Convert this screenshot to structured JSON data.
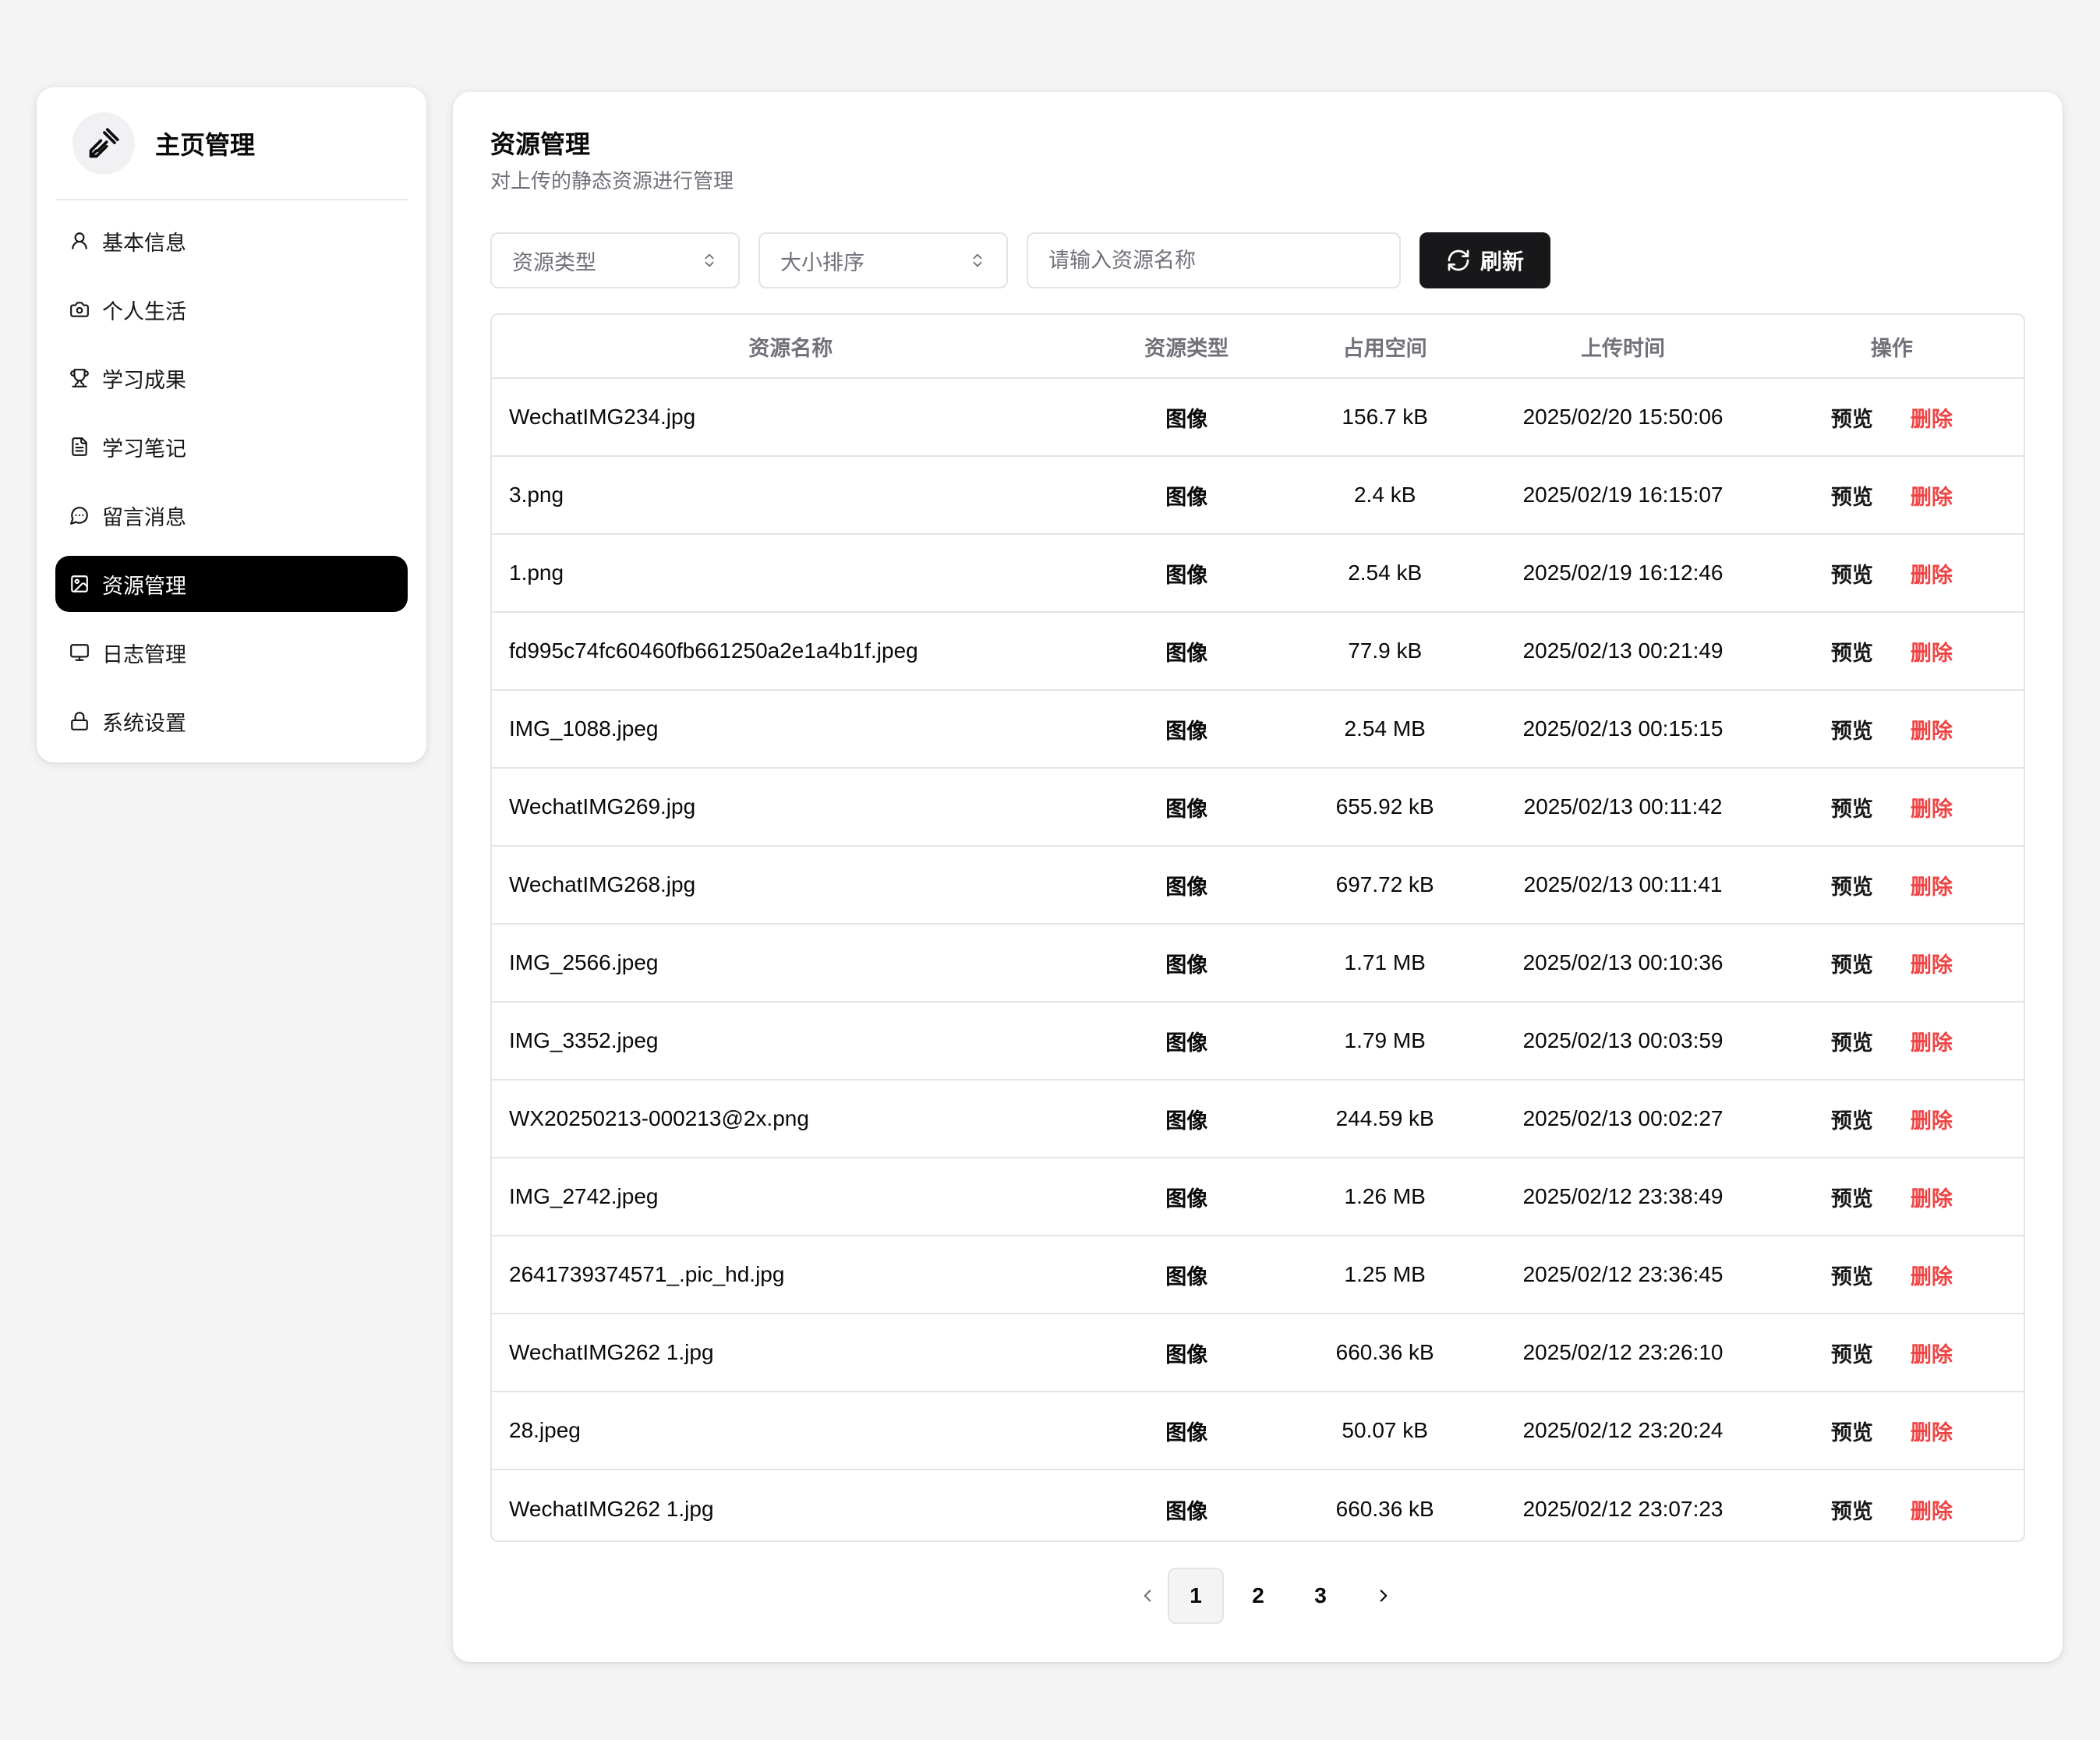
{
  "sidebar": {
    "title": "主页管理",
    "items": [
      {
        "label": "基本信息",
        "icon": "user-icon",
        "active": false
      },
      {
        "label": "个人生活",
        "icon": "camera-icon",
        "active": false
      },
      {
        "label": "学习成果",
        "icon": "trophy-icon",
        "active": false
      },
      {
        "label": "学习笔记",
        "icon": "file-text-icon",
        "active": false
      },
      {
        "label": "留言消息",
        "icon": "message-circle-icon",
        "active": false
      },
      {
        "label": "资源管理",
        "icon": "image-icon",
        "active": true
      },
      {
        "label": "日志管理",
        "icon": "monitor-icon",
        "active": false
      },
      {
        "label": "系统设置",
        "icon": "lock-icon",
        "active": false
      }
    ]
  },
  "page": {
    "title": "资源管理",
    "subtitle": "对上传的静态资源进行管理"
  },
  "filters": {
    "type_select": "资源类型",
    "sort_select": "大小排序",
    "search_placeholder": "请输入资源名称",
    "refresh_label": "刷新"
  },
  "table": {
    "headers": [
      "资源名称",
      "资源类型",
      "占用空间",
      "上传时间",
      "操作"
    ],
    "preview_label": "预览",
    "delete_label": "删除",
    "rows": [
      {
        "name": "WechatIMG234.jpg",
        "type": "图像",
        "size": "156.7 kB",
        "time": "2025/02/20 15:50:06"
      },
      {
        "name": "3.png",
        "type": "图像",
        "size": "2.4 kB",
        "time": "2025/02/19 16:15:07"
      },
      {
        "name": "1.png",
        "type": "图像",
        "size": "2.54 kB",
        "time": "2025/02/19 16:12:46"
      },
      {
        "name": "fd995c74fc60460fb661250a2e1a4b1f.jpeg",
        "type": "图像",
        "size": "77.9 kB",
        "time": "2025/02/13 00:21:49"
      },
      {
        "name": "IMG_1088.jpeg",
        "type": "图像",
        "size": "2.54 MB",
        "time": "2025/02/13 00:15:15"
      },
      {
        "name": "WechatIMG269.jpg",
        "type": "图像",
        "size": "655.92 kB",
        "time": "2025/02/13 00:11:42"
      },
      {
        "name": "WechatIMG268.jpg",
        "type": "图像",
        "size": "697.72 kB",
        "time": "2025/02/13 00:11:41"
      },
      {
        "name": "IMG_2566.jpeg",
        "type": "图像",
        "size": "1.71 MB",
        "time": "2025/02/13 00:10:36"
      },
      {
        "name": "IMG_3352.jpeg",
        "type": "图像",
        "size": "1.79 MB",
        "time": "2025/02/13 00:03:59"
      },
      {
        "name": "WX20250213-000213@2x.png",
        "type": "图像",
        "size": "244.59 kB",
        "time": "2025/02/13 00:02:27"
      },
      {
        "name": "IMG_2742.jpeg",
        "type": "图像",
        "size": "1.26 MB",
        "time": "2025/02/12 23:38:49"
      },
      {
        "name": "2641739374571_.pic_hd.jpg",
        "type": "图像",
        "size": "1.25 MB",
        "time": "2025/02/12 23:36:45"
      },
      {
        "name": "WechatIMG262 1.jpg",
        "type": "图像",
        "size": "660.36 kB",
        "time": "2025/02/12 23:26:10"
      },
      {
        "name": "28.jpeg",
        "type": "图像",
        "size": "50.07 kB",
        "time": "2025/02/12 23:20:24"
      },
      {
        "name": "WechatIMG262 1.jpg",
        "type": "图像",
        "size": "660.36 kB",
        "time": "2025/02/12 23:07:23"
      }
    ]
  },
  "pagination": {
    "pages": [
      "1",
      "2",
      "3"
    ],
    "current": "1"
  }
}
